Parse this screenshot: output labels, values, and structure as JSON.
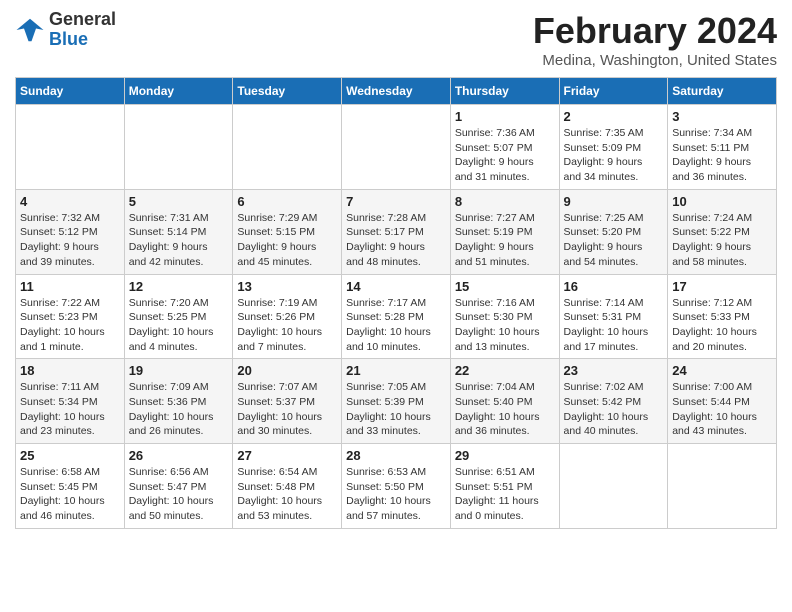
{
  "header": {
    "logo_general": "General",
    "logo_blue": "Blue",
    "title": "February 2024",
    "subtitle": "Medina, Washington, United States"
  },
  "weekdays": [
    "Sunday",
    "Monday",
    "Tuesday",
    "Wednesday",
    "Thursday",
    "Friday",
    "Saturday"
  ],
  "weeks": [
    [
      {
        "day": "",
        "info": ""
      },
      {
        "day": "",
        "info": ""
      },
      {
        "day": "",
        "info": ""
      },
      {
        "day": "",
        "info": ""
      },
      {
        "day": "1",
        "info": "Sunrise: 7:36 AM\nSunset: 5:07 PM\nDaylight: 9 hours\nand 31 minutes."
      },
      {
        "day": "2",
        "info": "Sunrise: 7:35 AM\nSunset: 5:09 PM\nDaylight: 9 hours\nand 34 minutes."
      },
      {
        "day": "3",
        "info": "Sunrise: 7:34 AM\nSunset: 5:11 PM\nDaylight: 9 hours\nand 36 minutes."
      }
    ],
    [
      {
        "day": "4",
        "info": "Sunrise: 7:32 AM\nSunset: 5:12 PM\nDaylight: 9 hours\nand 39 minutes."
      },
      {
        "day": "5",
        "info": "Sunrise: 7:31 AM\nSunset: 5:14 PM\nDaylight: 9 hours\nand 42 minutes."
      },
      {
        "day": "6",
        "info": "Sunrise: 7:29 AM\nSunset: 5:15 PM\nDaylight: 9 hours\nand 45 minutes."
      },
      {
        "day": "7",
        "info": "Sunrise: 7:28 AM\nSunset: 5:17 PM\nDaylight: 9 hours\nand 48 minutes."
      },
      {
        "day": "8",
        "info": "Sunrise: 7:27 AM\nSunset: 5:19 PM\nDaylight: 9 hours\nand 51 minutes."
      },
      {
        "day": "9",
        "info": "Sunrise: 7:25 AM\nSunset: 5:20 PM\nDaylight: 9 hours\nand 54 minutes."
      },
      {
        "day": "10",
        "info": "Sunrise: 7:24 AM\nSunset: 5:22 PM\nDaylight: 9 hours\nand 58 minutes."
      }
    ],
    [
      {
        "day": "11",
        "info": "Sunrise: 7:22 AM\nSunset: 5:23 PM\nDaylight: 10 hours\nand 1 minute."
      },
      {
        "day": "12",
        "info": "Sunrise: 7:20 AM\nSunset: 5:25 PM\nDaylight: 10 hours\nand 4 minutes."
      },
      {
        "day": "13",
        "info": "Sunrise: 7:19 AM\nSunset: 5:26 PM\nDaylight: 10 hours\nand 7 minutes."
      },
      {
        "day": "14",
        "info": "Sunrise: 7:17 AM\nSunset: 5:28 PM\nDaylight: 10 hours\nand 10 minutes."
      },
      {
        "day": "15",
        "info": "Sunrise: 7:16 AM\nSunset: 5:30 PM\nDaylight: 10 hours\nand 13 minutes."
      },
      {
        "day": "16",
        "info": "Sunrise: 7:14 AM\nSunset: 5:31 PM\nDaylight: 10 hours\nand 17 minutes."
      },
      {
        "day": "17",
        "info": "Sunrise: 7:12 AM\nSunset: 5:33 PM\nDaylight: 10 hours\nand 20 minutes."
      }
    ],
    [
      {
        "day": "18",
        "info": "Sunrise: 7:11 AM\nSunset: 5:34 PM\nDaylight: 10 hours\nand 23 minutes."
      },
      {
        "day": "19",
        "info": "Sunrise: 7:09 AM\nSunset: 5:36 PM\nDaylight: 10 hours\nand 26 minutes."
      },
      {
        "day": "20",
        "info": "Sunrise: 7:07 AM\nSunset: 5:37 PM\nDaylight: 10 hours\nand 30 minutes."
      },
      {
        "day": "21",
        "info": "Sunrise: 7:05 AM\nSunset: 5:39 PM\nDaylight: 10 hours\nand 33 minutes."
      },
      {
        "day": "22",
        "info": "Sunrise: 7:04 AM\nSunset: 5:40 PM\nDaylight: 10 hours\nand 36 minutes."
      },
      {
        "day": "23",
        "info": "Sunrise: 7:02 AM\nSunset: 5:42 PM\nDaylight: 10 hours\nand 40 minutes."
      },
      {
        "day": "24",
        "info": "Sunrise: 7:00 AM\nSunset: 5:44 PM\nDaylight: 10 hours\nand 43 minutes."
      }
    ],
    [
      {
        "day": "25",
        "info": "Sunrise: 6:58 AM\nSunset: 5:45 PM\nDaylight: 10 hours\nand 46 minutes."
      },
      {
        "day": "26",
        "info": "Sunrise: 6:56 AM\nSunset: 5:47 PM\nDaylight: 10 hours\nand 50 minutes."
      },
      {
        "day": "27",
        "info": "Sunrise: 6:54 AM\nSunset: 5:48 PM\nDaylight: 10 hours\nand 53 minutes."
      },
      {
        "day": "28",
        "info": "Sunrise: 6:53 AM\nSunset: 5:50 PM\nDaylight: 10 hours\nand 57 minutes."
      },
      {
        "day": "29",
        "info": "Sunrise: 6:51 AM\nSunset: 5:51 PM\nDaylight: 11 hours\nand 0 minutes."
      },
      {
        "day": "",
        "info": ""
      },
      {
        "day": "",
        "info": ""
      }
    ]
  ]
}
